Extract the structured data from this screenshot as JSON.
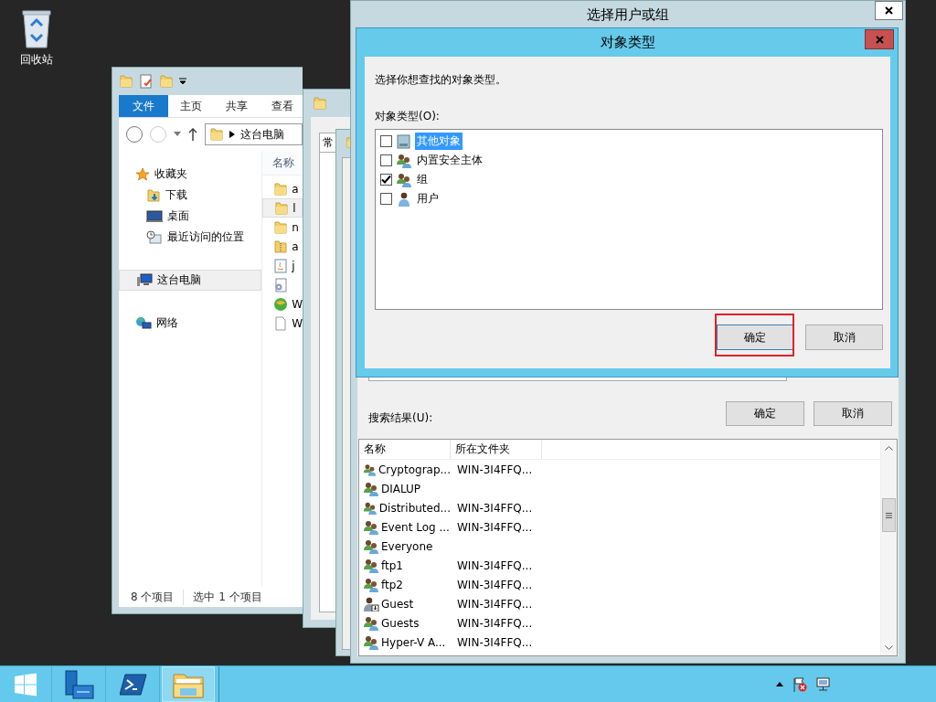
{
  "desktop_icons": [
    {
      "label": "回收站",
      "kind": "recycle-bin"
    }
  ],
  "explorer": {
    "ribbon_tabs": [
      {
        "label": "文件",
        "selected": true
      },
      {
        "label": "主页",
        "selected": false
      },
      {
        "label": "共享",
        "selected": false
      },
      {
        "label": "查看",
        "selected": false
      }
    ],
    "address": "这台电脑",
    "nav": [
      {
        "label": "收藏夹",
        "kind": "star",
        "selected": false,
        "children": [
          {
            "label": "下载",
            "kind": "download",
            "selected": false
          },
          {
            "label": "桌面",
            "kind": "desktop",
            "selected": false
          },
          {
            "label": "最近访问的位置",
            "kind": "recent",
            "selected": false
          }
        ]
      },
      {
        "label": "这台电脑",
        "kind": "computer",
        "selected": true
      },
      {
        "label": "网络",
        "kind": "network",
        "selected": false
      }
    ],
    "column_header": "名称",
    "files": [
      {
        "name": "a",
        "kind": "folder",
        "selected": false
      },
      {
        "name": "l",
        "kind": "folder",
        "selected": true
      },
      {
        "name": "n",
        "kind": "folder",
        "selected": false
      },
      {
        "name": "a",
        "kind": "zip",
        "selected": false
      },
      {
        "name": "j",
        "kind": "java",
        "selected": false
      },
      {
        "kind": "config",
        "selected": false
      },
      {
        "name": "W",
        "kind": "globe",
        "selected": false
      },
      {
        "name": "W",
        "kind": "file",
        "selected": false
      }
    ],
    "status": [
      "8 个项目",
      "选中 1 个项目"
    ]
  },
  "properties_window": {
    "tab": "常"
  },
  "select_dialog": {
    "title": "选择用户或组",
    "buttons": [
      "确定",
      "取消"
    ],
    "results_label": "搜索结果(U):",
    "columns": [
      "名称",
      "所在文件夹"
    ],
    "rows": [
      {
        "name": "Cryptograp...",
        "folder": "WIN-3I4FFQ...",
        "kind": "group"
      },
      {
        "name": "DIALUP",
        "kind": "group"
      },
      {
        "name": "Distributed...",
        "folder": "WIN-3I4FFQ...",
        "kind": "group"
      },
      {
        "name": "Event Log ...",
        "folder": "WIN-3I4FFQ...",
        "kind": "group"
      },
      {
        "name": "Everyone",
        "kind": "group"
      },
      {
        "name": "ftp1",
        "folder": "WIN-3I4FFQ...",
        "kind": "group"
      },
      {
        "name": "ftp2",
        "folder": "WIN-3I4FFQ...",
        "kind": "group"
      },
      {
        "name": "Guest",
        "folder": "WIN-3I4FFQ...",
        "kind": "user"
      },
      {
        "name": "Guests",
        "folder": "WIN-3I4FFQ...",
        "kind": "group"
      },
      {
        "name": "Hyper-V A...",
        "folder": "WIN-3I4FFQ...",
        "kind": "group"
      }
    ]
  },
  "object_types_dialog": {
    "title": "对象类型",
    "prompt": "选择你想查找的对象类型。",
    "list_label": "对象类型(O):",
    "items": [
      {
        "label": "其他对象",
        "kind": "other",
        "checked": false,
        "selected": true
      },
      {
        "label": "内置安全主体",
        "kind": "group",
        "checked": false,
        "selected": false
      },
      {
        "label": "组",
        "kind": "group",
        "checked": true,
        "selected": false
      },
      {
        "label": "用户",
        "kind": "user",
        "checked": false,
        "selected": false
      }
    ],
    "buttons": [
      {
        "label": "确定",
        "focused": true,
        "highlighted": true
      },
      {
        "label": "取消",
        "focused": false,
        "highlighted": false
      }
    ]
  },
  "taskbar": {
    "items": [
      {
        "kind": "start",
        "selected": false
      },
      {
        "kind": "server-manager",
        "selected": false
      },
      {
        "kind": "powershell",
        "selected": false
      },
      {
        "kind": "explorer",
        "selected": true
      }
    ],
    "tray": [
      {
        "kind": "caret"
      },
      {
        "kind": "flag"
      },
      {
        "kind": "network"
      }
    ]
  }
}
